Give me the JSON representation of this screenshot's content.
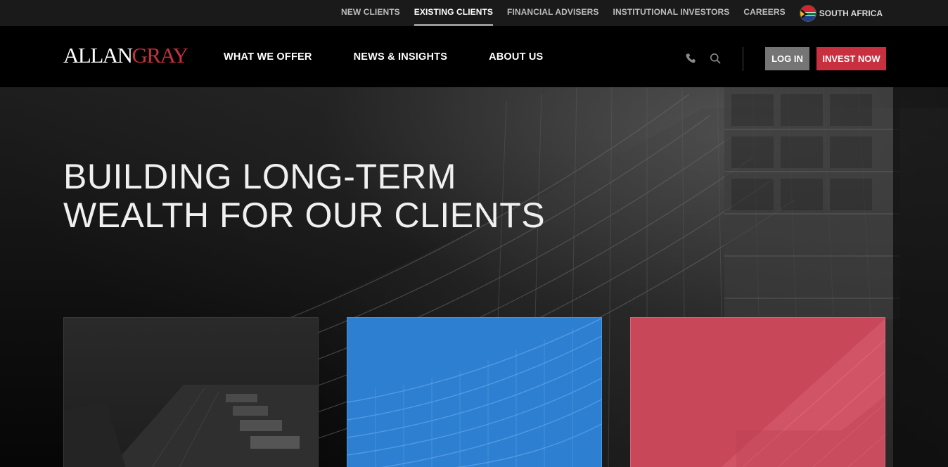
{
  "topbar": {
    "links": [
      {
        "label": "NEW CLIENTS",
        "active": false
      },
      {
        "label": "EXISTING CLIENTS",
        "active": true
      },
      {
        "label": "FINANCIAL ADVISERS",
        "active": false
      },
      {
        "label": "INSTITUTIONAL INVESTORS",
        "active": false
      },
      {
        "label": "CAREERS",
        "active": false
      }
    ],
    "region": {
      "label": "SOUTH AFRICA",
      "icon": "south-africa-flag-icon"
    }
  },
  "header": {
    "logo": {
      "part1": "ALLAN",
      "part2": "GRAY"
    },
    "nav": [
      "WHAT WE OFFER",
      "NEWS & INSIGHTS",
      "ABOUT US"
    ],
    "icons": [
      "phone-icon",
      "search-icon"
    ],
    "login_label": "LOG IN",
    "invest_label": "INVEST NOW"
  },
  "hero": {
    "headline_line1": "BUILDING LONG-TERM",
    "headline_line2": "WEALTH FOR OUR CLIENTS"
  },
  "colors": {
    "brand_red": "#c8303f",
    "card_blue": "#2c7fd1",
    "card_red": "#c8485a",
    "login_gray": "#757575"
  }
}
